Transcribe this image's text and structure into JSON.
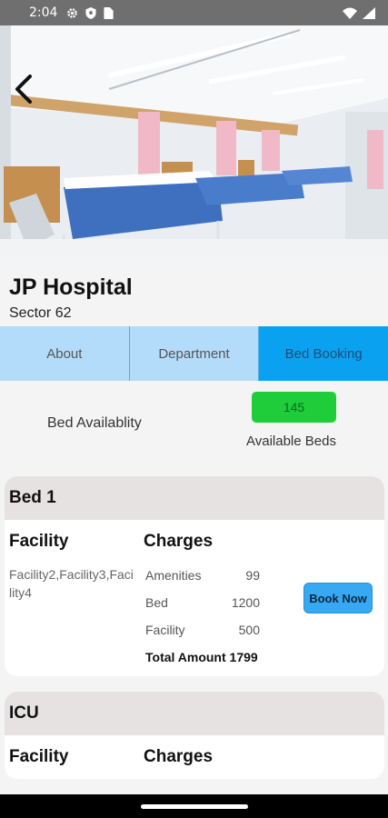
{
  "status": {
    "time": "2:04"
  },
  "hospital": {
    "name": "JP Hospital",
    "sector": "Sector 62"
  },
  "tabs": [
    {
      "label": "About"
    },
    {
      "label": "Department"
    },
    {
      "label": "Bed Booking",
      "active": true
    }
  ],
  "availability": {
    "label": "Bed Availablity",
    "count": "145",
    "caption": "Available Beds"
  },
  "cards": [
    {
      "title": "Bed 1",
      "facility_header": "Facility",
      "charges_header": "Charges",
      "facilities": "Facility2,Facility3,Facility4",
      "charges": [
        {
          "name": "Amenities",
          "amount": "99"
        },
        {
          "name": "Bed",
          "amount": "1200"
        },
        {
          "name": "Facility",
          "amount": "500"
        }
      ],
      "total": "Total Amount 1799",
      "button": "Book Now"
    },
    {
      "title": "ICU",
      "facility_header": "Facility",
      "charges_header": "Charges"
    }
  ],
  "colors": {
    "tab_inactive": "#b3dcfa",
    "tab_active": "#0aa2f0",
    "count_badge": "#1fcd3a",
    "book_button": "#37a9f2"
  },
  "icons": [
    "gear-icon",
    "shield-icon",
    "sim-card-icon",
    "wifi-icon",
    "signal-icon",
    "back-arrow-icon"
  ]
}
